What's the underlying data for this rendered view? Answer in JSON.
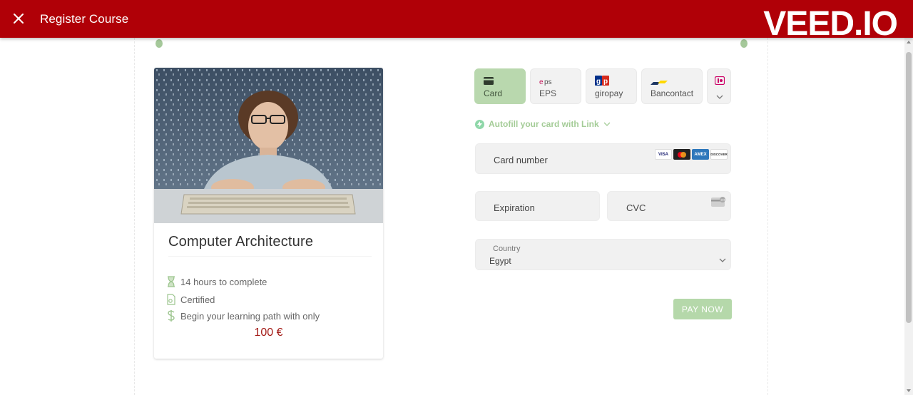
{
  "header": {
    "title": "Register Course",
    "watermark": "VEED.IO",
    "background_color": "#b00007"
  },
  "course": {
    "name": "Computer Architecture",
    "features": [
      {
        "icon": "hourglass-icon",
        "text": "14 hours to complete"
      },
      {
        "icon": "certificate-icon",
        "text": "Certified"
      },
      {
        "icon": "dollar-icon",
        "text": "Begin your learning path with only"
      }
    ],
    "price": "100 €",
    "price_color": "#a31a16"
  },
  "payment": {
    "methods": [
      {
        "label": "Card",
        "icon": "card-icon",
        "active": true
      },
      {
        "label": "EPS",
        "icon": "eps-icon",
        "active": false
      },
      {
        "label": "giropay",
        "icon": "giropay-icon",
        "active": false
      },
      {
        "label": "Bancontact",
        "icon": "bancontact-icon",
        "active": false
      },
      {
        "label": "",
        "icon": "more-methods-icon",
        "active": false
      }
    ],
    "autofill_label": "Autofill your card with Link",
    "card_number_placeholder": "Card number",
    "card_brands": [
      "VISA",
      "Mastercard",
      "AMEX",
      "DISCOVER"
    ],
    "expiration_placeholder": "Expiration",
    "cvc_placeholder": "CVC",
    "country_label": "Country",
    "country_value": "Egypt",
    "pay_button": "PAY NOW",
    "accent_color": "#b5d8aa"
  }
}
